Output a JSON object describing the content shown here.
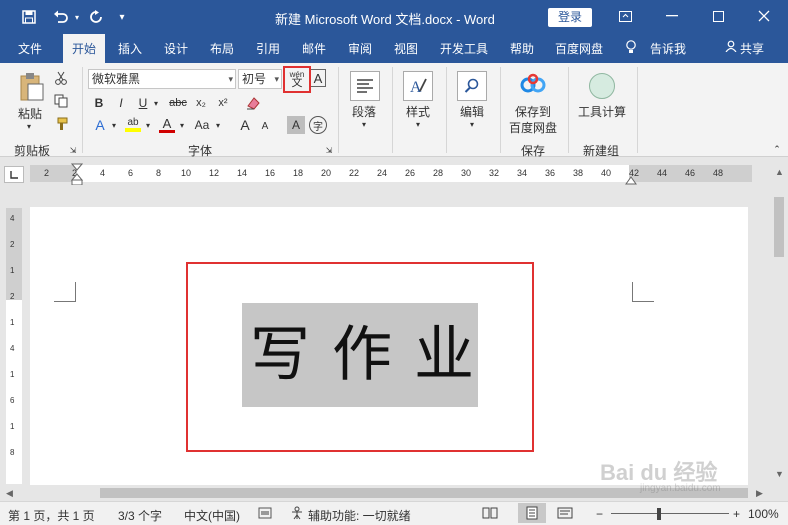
{
  "titlebar": {
    "title": "新建 Microsoft Word 文档.docx  -  Word",
    "login": "登录",
    "save_icon": "save-icon",
    "undo_icon": "undo-icon",
    "redo_icon": "redo-icon",
    "customize_icon": "dropdown-icon"
  },
  "menu": {
    "file": "文件",
    "home": "开始",
    "insert": "插入",
    "design": "设计",
    "layout": "布局",
    "references": "引用",
    "mailings": "邮件",
    "review": "审阅",
    "view": "视图",
    "developer": "开发工具",
    "help": "帮助",
    "baidu": "百度网盘",
    "tellme": "告诉我",
    "share": "共享"
  },
  "ribbon": {
    "clipboard": {
      "paste": "粘贴",
      "label": "剪贴板"
    },
    "font": {
      "name": "微软雅黑",
      "size": "初号",
      "label": "字体",
      "bold": "B",
      "italic": "I",
      "underline": "U",
      "strike": "abc",
      "sub": "x₂",
      "sup": "x²",
      "textcolor": "A",
      "case": "Aa",
      "grow": "A",
      "shrink": "A",
      "phonetic_top": "wén",
      "phonetic_bottom": "文",
      "char_border": "A",
      "char_shading": "A",
      "enclose": "字",
      "highlight": "ab",
      "effects": "A",
      "border_box": "A"
    },
    "paragraph": {
      "label": "段落"
    },
    "styles": {
      "label": "样式"
    },
    "editing": {
      "label": "编辑"
    },
    "save": {
      "line1": "保存到",
      "line2": "百度网盘",
      "label": "保存"
    },
    "newgroup": {
      "tool": "工具计算",
      "label": "新建组"
    }
  },
  "ruler": {
    "ticks": [
      "2",
      "2",
      "4",
      "6",
      "8",
      "10",
      "12",
      "14",
      "16",
      "18",
      "20",
      "22",
      "24",
      "26",
      "28",
      "30",
      "32",
      "34",
      "36",
      "38",
      "40",
      "42",
      "44",
      "46",
      "48"
    ],
    "vticks": [
      "4",
      "2",
      "1",
      "2",
      "1",
      "4",
      "1",
      "6",
      "1",
      "8"
    ]
  },
  "document": {
    "text": "写作业"
  },
  "status": {
    "page": "第 1 页，共 1 页",
    "words": "3/3 个字",
    "language": "中文(中国)",
    "accessibility": "辅助功能: 一切就绪",
    "zoom": "100%",
    "zoom_minus": "−",
    "zoom_plus": "+"
  },
  "watermark": {
    "text": "Bai du 经验",
    "sub": "jingyan.baidu.com"
  }
}
